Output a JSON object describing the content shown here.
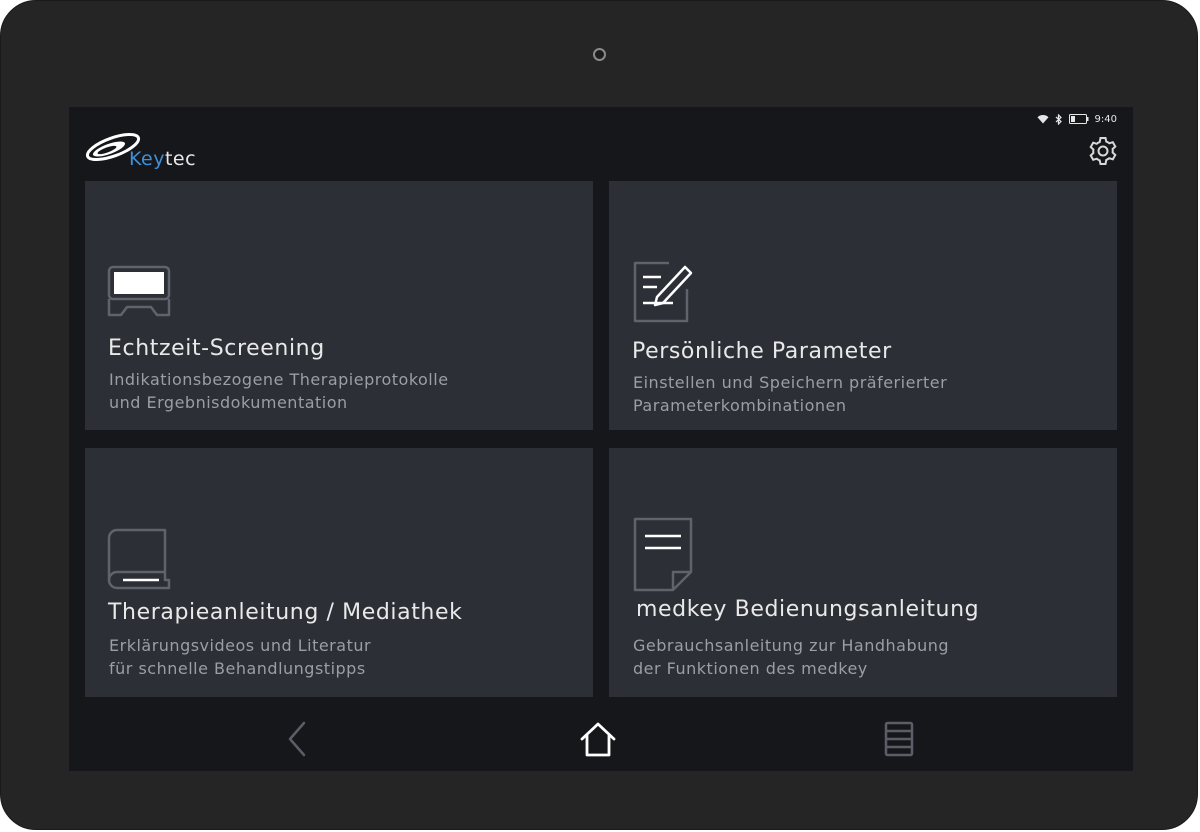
{
  "status_bar": {
    "time": "9:40",
    "icons": [
      "wifi-icon",
      "bluetooth-icon",
      "battery-icon"
    ]
  },
  "header": {
    "logo_prefix": "Key",
    "logo_suffix": "tec",
    "settings_icon": "gear-icon"
  },
  "cards": [
    {
      "icon": "screening-device-icon",
      "title": "Echtzeit-Screening",
      "description": "Indikationsbezogene Therapieprotokolle\nund Ergebnisdokumentation"
    },
    {
      "icon": "edit-document-icon",
      "title": "Persönliche Parameter",
      "description": "Einstellen und Speichern präferierter\nParameterkombinationen"
    },
    {
      "icon": "book-icon",
      "title": "Therapieanleitung / Mediathek",
      "description": "Erklärungsvideos und Literatur\nfür schnelle Behandlungstipps"
    },
    {
      "icon": "manual-document-icon",
      "title": "medkey Bedienungsanleitung",
      "description": "Gebrauchsanleitung zur Handhabung\nder Funktionen des medkey"
    }
  ],
  "navigation": {
    "back_icon": "back-chevron-icon",
    "home_icon": "home-icon",
    "recent_icon": "recent-apps-icon"
  },
  "colors": {
    "bezel": "#252525",
    "screen_background": "#16171b",
    "card_background": "#2c2f35",
    "title_text": "#e9e9e9",
    "description_text": "#9a9ea6",
    "logo_accent": "#3d8fd6"
  }
}
